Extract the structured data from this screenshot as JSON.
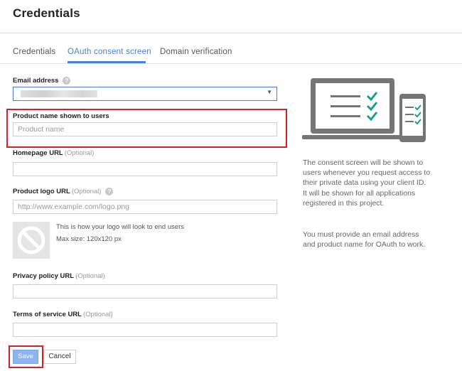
{
  "header": {
    "title": "Credentials"
  },
  "tabs": [
    {
      "label": "Credentials",
      "active": false
    },
    {
      "label": "OAuth consent screen",
      "active": true
    },
    {
      "label": "Domain verification",
      "active": false
    }
  ],
  "form": {
    "email": {
      "label": "Email address",
      "help_icon": "question-icon",
      "value": "",
      "dropdown_icon": "triangle-down"
    },
    "product_name": {
      "label": "Product name shown to users",
      "placeholder": "Product name"
    },
    "homepage": {
      "label": "Homepage URL",
      "optional": "(Optional)",
      "placeholder": ""
    },
    "product_logo": {
      "label": "Product logo URL",
      "optional": "(Optional)",
      "help_icon": "question-icon",
      "placeholder": "http://www.example.com/logo.png",
      "preview_icon": "no-image-icon",
      "hint_line1": "This is how your logo will look to end users",
      "hint_line2": "Max size: 120x120 px"
    },
    "privacy": {
      "label": "Privacy policy URL",
      "optional": "(Optional)",
      "placeholder": ""
    },
    "terms": {
      "label": "Terms of service URL",
      "optional": "(Optional)",
      "placeholder": ""
    }
  },
  "actions": {
    "save_label": "Save",
    "cancel_label": "Cancel"
  },
  "info": {
    "paragraph1": "The consent screen will be shown to users whenever you request access to their private data using your client ID. It will be shown for all applications registered in this project.",
    "paragraph2": "You must provide an email address and product name for OAuth to work."
  },
  "colors": {
    "accent": "#4a80d8",
    "highlight": "#d71f26",
    "checkmark": "#1a9e8c",
    "save_button": "#8db4ee"
  }
}
